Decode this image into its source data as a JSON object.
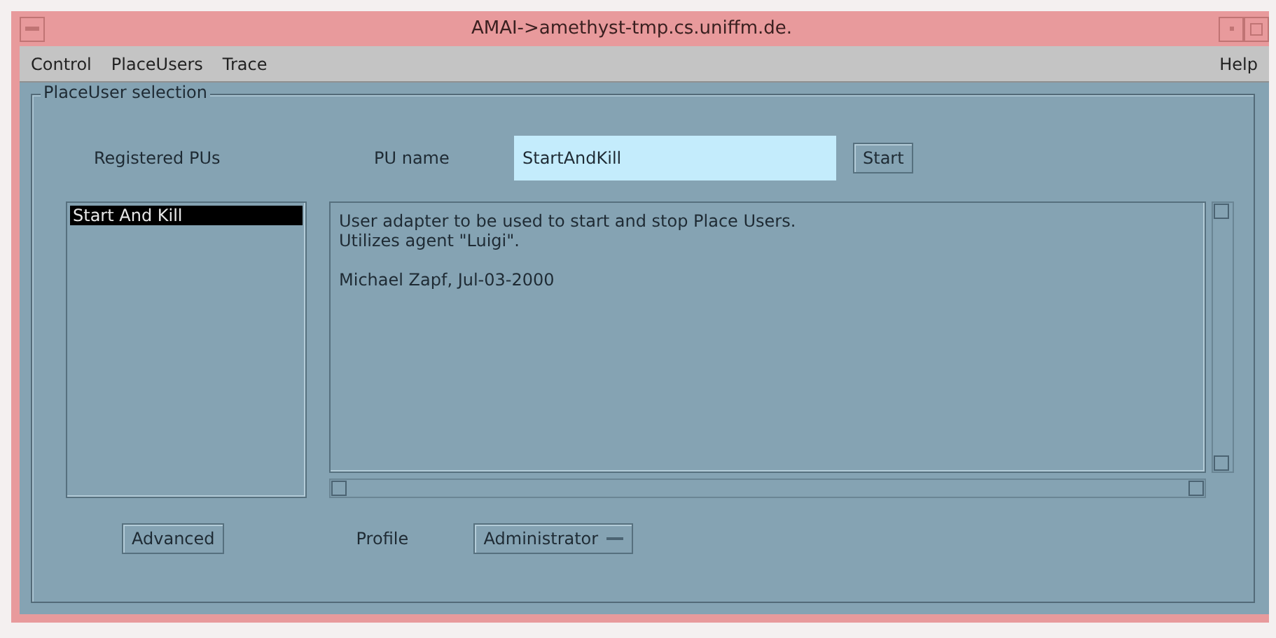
{
  "window": {
    "title": "AMAI->amethyst-tmp.cs.uniffm.de."
  },
  "menu": [
    {
      "label": "Control"
    },
    {
      "label": "PlaceUsers"
    },
    {
      "label": "Trace"
    }
  ],
  "help_menu": "Help",
  "panel": {
    "title": "PlaceUser selection",
    "registered_label": "Registered PUs",
    "pu_name_label": "PU name",
    "pu_name": "StartAndKill",
    "start_button": "Start",
    "pu_list": [
      {
        "label": "Start And Kill",
        "selected": true
      }
    ],
    "description": [
      "User adapter to be used to start and stop Place Users.",
      "Utilizes agent \"Luigi\"."
    ],
    "signature": "Michael Zapf, Jul-03-2000",
    "advanced_button": "Advanced",
    "profile_label": "Profile",
    "profile": "Administrator"
  }
}
